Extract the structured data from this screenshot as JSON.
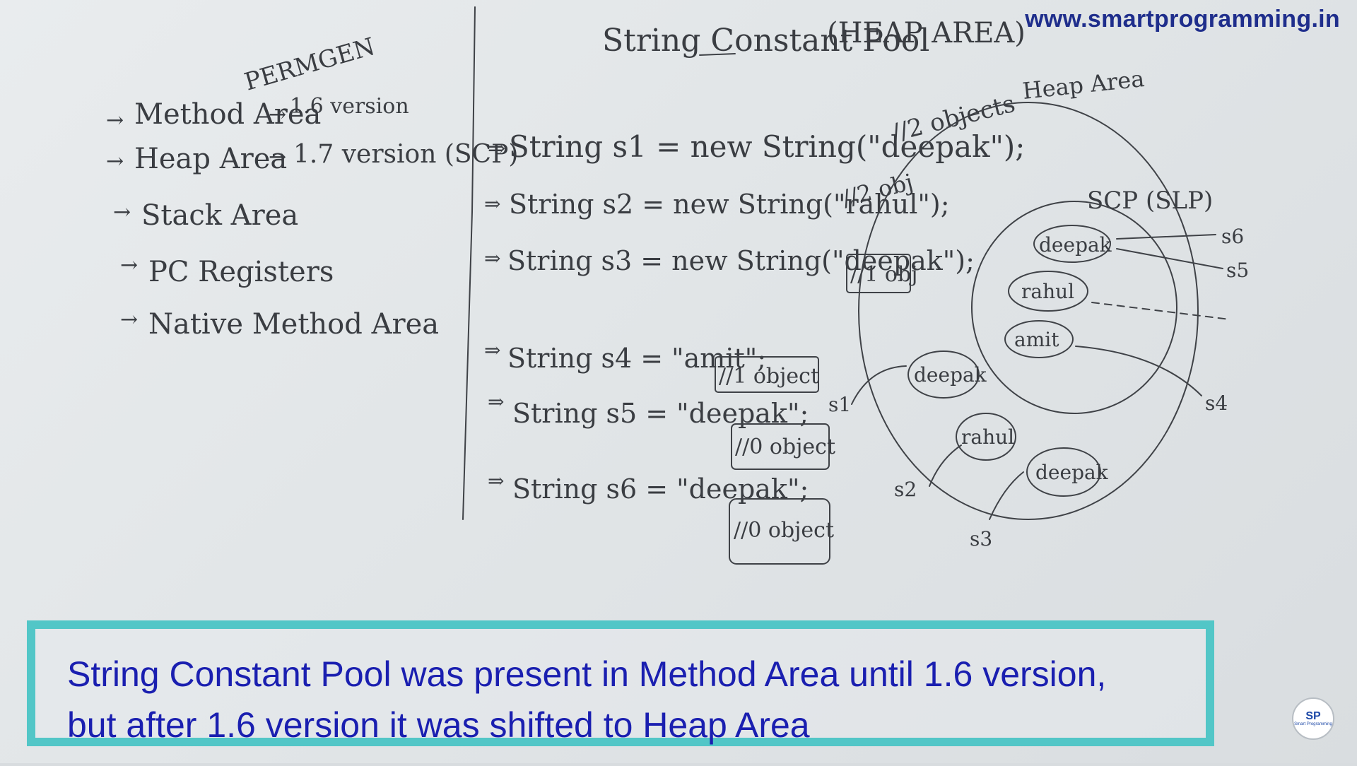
{
  "website_url": "www.smartprogramming.in",
  "board": {
    "title": "String Constant Pool",
    "title_tag": "(HEAP AREA)",
    "permgen_label": "PERMGEN",
    "memory_areas": [
      {
        "label": "Method Area",
        "note": "1.6 version"
      },
      {
        "label": "Heap Area",
        "note": "1.7 version (SCP)"
      },
      {
        "label": "Stack Area",
        "note": ""
      },
      {
        "label": "PC Registers",
        "note": ""
      },
      {
        "label": "Native Method Area",
        "note": ""
      }
    ],
    "code_lines": [
      {
        "code": "String s1 = new String(\"deepak\");",
        "comment": "//2 objects"
      },
      {
        "code": "String s2 = new String(\"rahul\");",
        "comment": "//2 obj"
      },
      {
        "code": "String s3 = new String(\"deepak\");",
        "comment": "//1 obj"
      },
      {
        "code": "String s4 = \"amit\";",
        "comment": "//1 object"
      },
      {
        "code": "String s5 = \"deepak\";",
        "comment": "//0 object"
      },
      {
        "code": "String s6 = \"deepak\";",
        "comment": "//0 object"
      }
    ],
    "diagram": {
      "heap_label": "Heap Area",
      "scp_label": "SCP (SLP)",
      "scp_objects": [
        "deepak",
        "rahul",
        "amit"
      ],
      "heap_objects": [
        "deepak",
        "rahul",
        "deepak"
      ],
      "references": [
        "s1",
        "s2",
        "s3",
        "s4",
        "s5",
        "s6"
      ]
    }
  },
  "caption": {
    "line1": "String Constant Pool was  present in Method Area until 1.6 version,",
    "line2": "but after 1.6 version it was shifted to Heap Area"
  },
  "logo": {
    "mark": "SP",
    "text": "Smart Programming"
  },
  "colors": {
    "caption_border": "#52c6c7",
    "caption_text": "#1a1fb0",
    "url_text": "#1f2e8c"
  }
}
